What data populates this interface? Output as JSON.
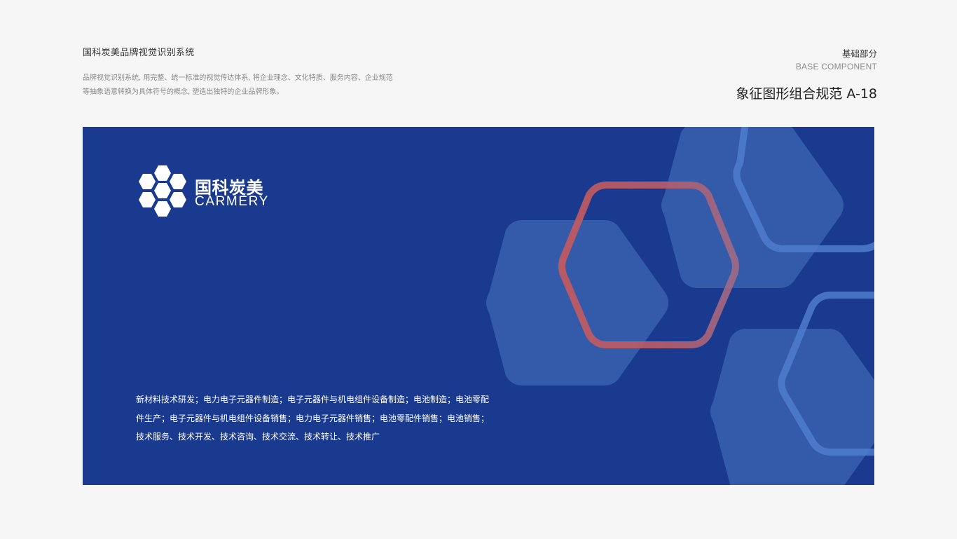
{
  "header": {
    "title": "国科炭美品牌视觉识别系统",
    "description": "品牌视觉识别系统, 用完整、统一标准的视觉传达体系, 将企业理念、文化特质、服务内容、企业规范等抽象语意转换为具体符号的概念, 塑造出独特的企业品牌形象。"
  },
  "section": {
    "label_cn": "基础部分",
    "label_en": "BASE COMPONENT",
    "spec_title": "象征图形组合规范 A-18"
  },
  "panel": {
    "background": "#1a3a8f",
    "logo": {
      "name_cn": "国科炭美",
      "name_en": "CARMERY",
      "icon": "hexagon-cluster-icon"
    },
    "business_scope": "新材料技术研发；电力电子元器件制造；电子元器件与机电组件设备制造；电池制造；电池零配件生产；电子元器件与机电组件设备销售；电力电子元器件销售；电池零配件销售；电池销售；技术服务、技术开发、技术咨询、技术交流、技术转让、技术推广"
  },
  "colors": {
    "brand_blue": "#1a3a8f",
    "hex_fill": "#3a64b0",
    "hex_outline_red": "#c0595f",
    "hex_outline_light": "#4f7ccc"
  }
}
